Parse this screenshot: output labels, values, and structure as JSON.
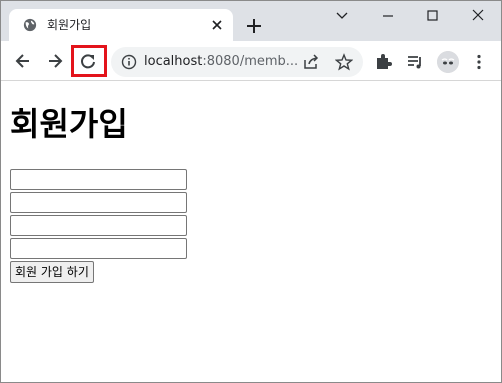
{
  "tab": {
    "title": "회원가입",
    "favicon": "globe-icon",
    "close": "close-icon"
  },
  "window_controls": [
    "chevron-down-icon",
    "minimize-icon",
    "maximize-icon",
    "close-icon"
  ],
  "toolbar": {
    "back": "arrow-left-icon",
    "forward": "arrow-right-icon",
    "reload": "reload-icon",
    "highlight_color": "#e3131b"
  },
  "omnibox": {
    "url_host": "localhost",
    "url_rest": ":8080/memb...",
    "info_icon": "info-icon",
    "share_icon": "share-icon",
    "star_icon": "star-icon"
  },
  "extensions": [
    "puzzle-icon",
    "media-list-icon",
    "avatar",
    "kebab-menu-icon"
  ],
  "page": {
    "heading": "회원가입",
    "fields": [
      {
        "value": "",
        "placeholder": ""
      },
      {
        "value": "",
        "placeholder": ""
      },
      {
        "value": "",
        "placeholder": ""
      },
      {
        "value": "",
        "placeholder": ""
      }
    ],
    "submit_label": "회원 가입 하기"
  },
  "colors": {
    "tabstrip_bg": "#dee1e6",
    "omnibox_bg": "#f1f3f4"
  }
}
